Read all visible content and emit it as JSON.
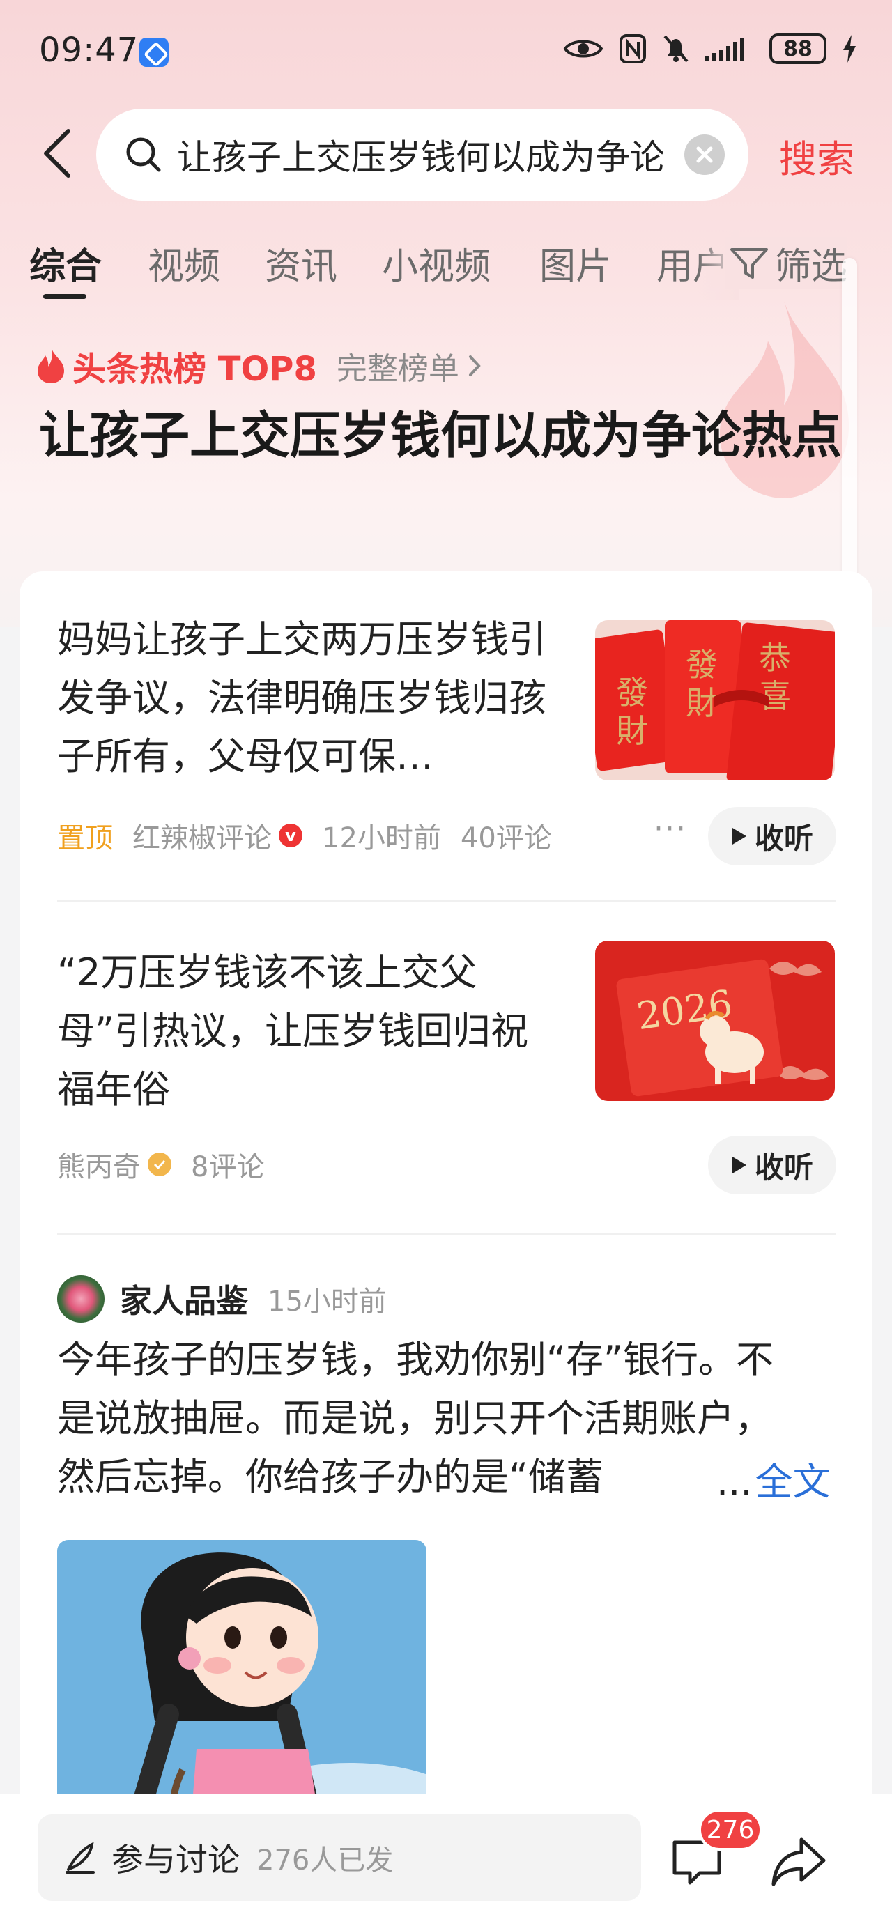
{
  "status_bar": {
    "time": "09:47",
    "battery": "88"
  },
  "search": {
    "query": "让孩子上交压岁钱何以成为争论热点",
    "button_label": "搜索"
  },
  "tabs": [
    {
      "label": "综合"
    },
    {
      "label": "视频"
    },
    {
      "label": "资讯"
    },
    {
      "label": "小视频"
    },
    {
      "label": "图片"
    },
    {
      "label": "用户"
    }
  ],
  "filter_label": "筛选",
  "hot_list": {
    "label": "头条热榜 TOP8",
    "full_list_link": "完整榜单"
  },
  "topic_title": "让孩子上交压岁钱何以成为争论热点",
  "news": [
    {
      "title": "妈妈让孩子上交两万压岁钱引发争议，法律明确压岁钱归孩子所有，父母仅可保…",
      "pin": "置顶",
      "source": "红辣椒评论",
      "verified_badge": "v",
      "time": "12小时前",
      "comments": "40评论",
      "listen_label": "收听"
    },
    {
      "title": "“2万压岁钱该不该上交父母”引热议，让压岁钱回归祝福年俗",
      "source": "熊丙奇",
      "comments": "8评论",
      "listen_label": "收听",
      "image_text": "2026"
    }
  ],
  "post": {
    "author": "家人品鉴",
    "time": "15小时前",
    "lines": [
      "今年孩子的压岁钱，我劝你别“存”银行。不",
      "是说放抽屉。而是说，别只开个活期账户，",
      "然后忘掉。你给孩子办的是“储蓄"
    ],
    "ellipsis": "...",
    "full_text_link": "全文"
  },
  "bottom_bar": {
    "discuss_label": "参与讨论",
    "discuss_count": "276人已发",
    "comment_badge": "276"
  },
  "colors": {
    "accent_red": "#f04142",
    "link_blue": "#2a6fd8",
    "pin_orange": "#f0a01e"
  }
}
